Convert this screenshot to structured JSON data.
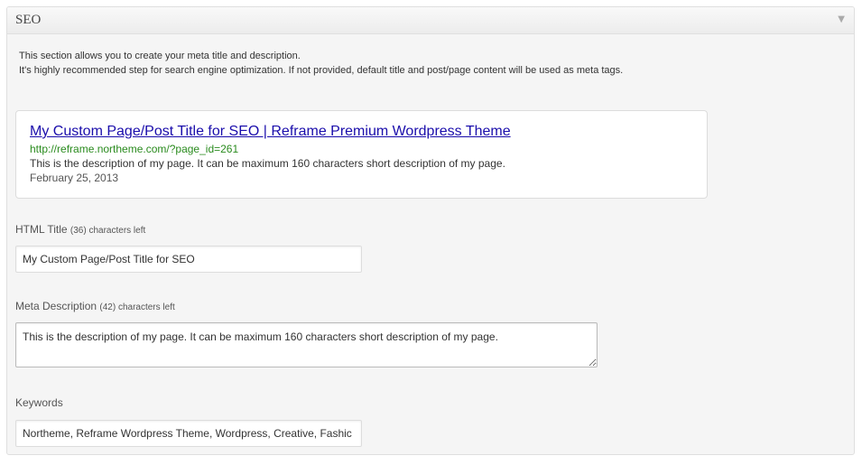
{
  "metabox": {
    "title": "SEO",
    "toggle_icon": "triangle-down-icon"
  },
  "intro": {
    "line1": "This section allows you to create your meta title and description.",
    "line2": "It's highly recommended step for search engine optimization. If not provided, default title and post/page content will be used as meta tags."
  },
  "preview": {
    "title": "My Custom Page/Post Title for SEO | Reframe Premium Wordpress Theme",
    "url": "http://reframe.northeme.com/?page_id=261",
    "description": "This is the description of my page. It can be maximum 160 characters short description of my page.",
    "date": "February 25, 2013"
  },
  "html_title": {
    "label": "HTML Title",
    "counter": "(36) characters left",
    "value": "My Custom Page/Post Title for SEO"
  },
  "meta_description": {
    "label": "Meta Description",
    "counter": "(42) characters left",
    "value": "This is the description of my page. It can be maximum 160 characters short description of my page."
  },
  "keywords": {
    "label": "Keywords",
    "value": "Northeme, Reframe Wordpress Theme, Wordpress, Creative, Fashic"
  },
  "colors": {
    "link": "#1a0dab",
    "url": "#2a8b1e",
    "panel_bg": "#f5f5f5",
    "border": "#dfdfdf"
  }
}
